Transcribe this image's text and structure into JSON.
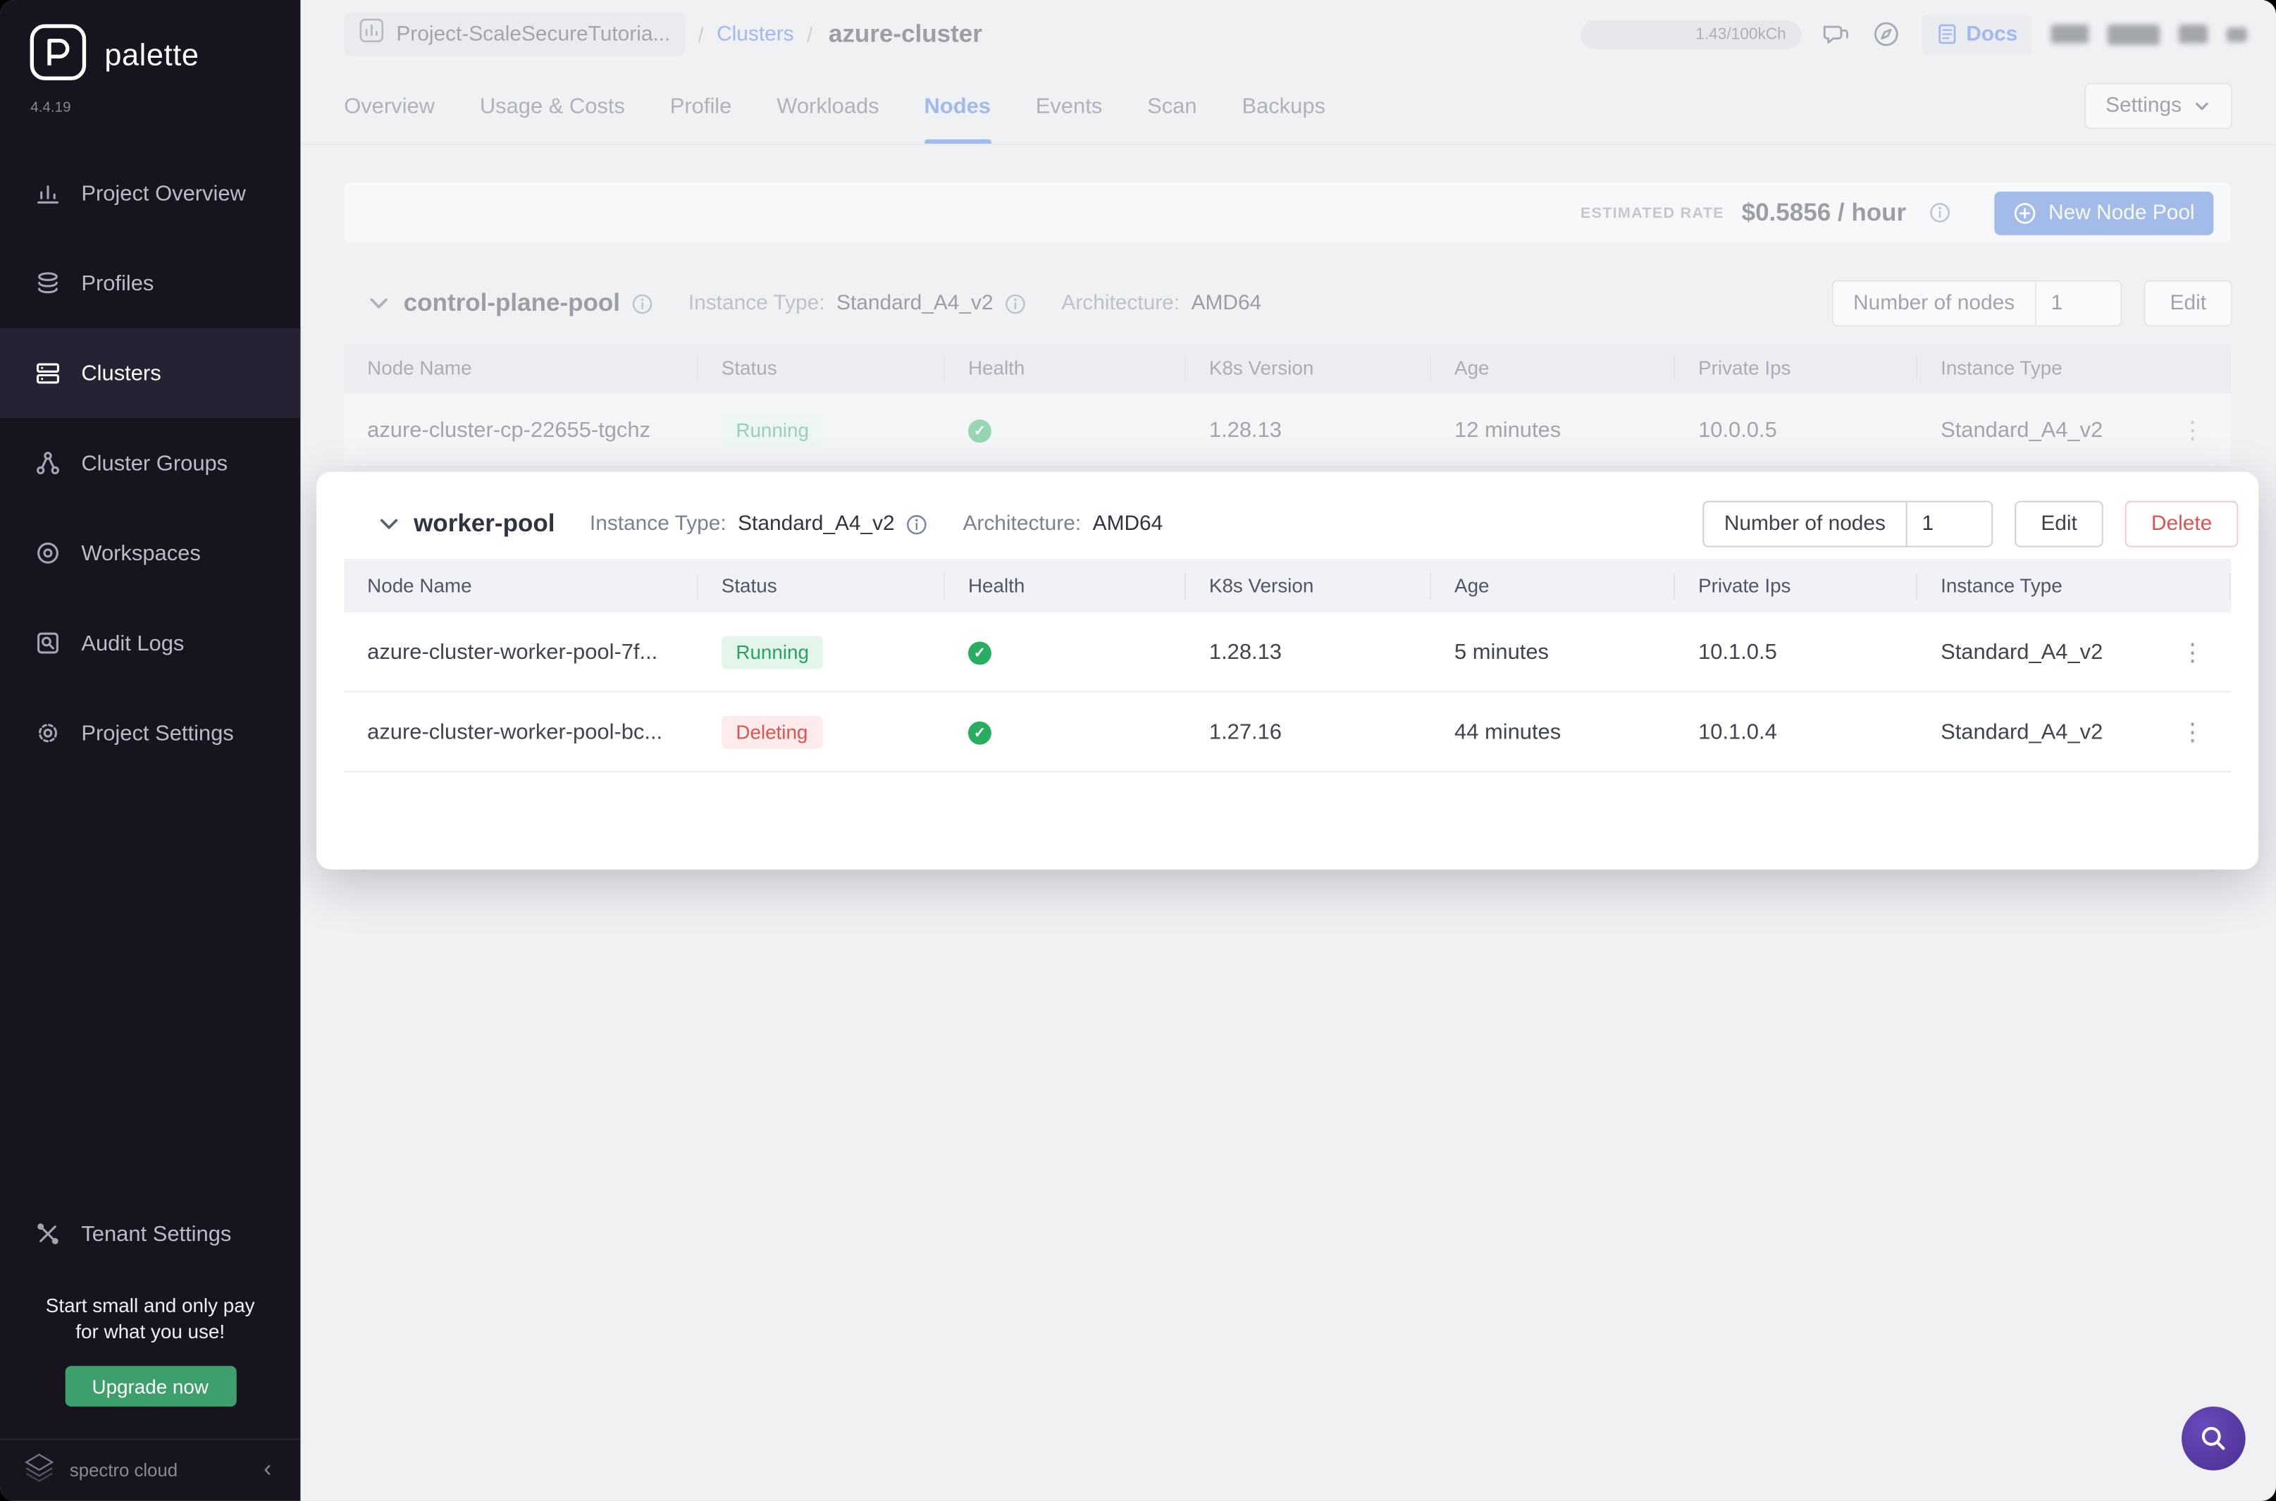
{
  "colors": {
    "accent_blue": "#3d6fe0",
    "success_green": "#27a35f",
    "danger_red": "#e0524e",
    "sidebar_bg": "#17141f",
    "upgrade_green": "#3da06c",
    "help_purple": "#4b2f91"
  },
  "sidebar": {
    "brand": "palette",
    "version": "4.4.19",
    "items": [
      {
        "label": "Project Overview"
      },
      {
        "label": "Profiles"
      },
      {
        "label": "Clusters"
      },
      {
        "label": "Cluster Groups"
      },
      {
        "label": "Workspaces"
      },
      {
        "label": "Audit Logs"
      },
      {
        "label": "Project Settings"
      }
    ],
    "tenant_settings": "Tenant Settings",
    "promo_line1": "Start small and only pay",
    "promo_line2": "for what you use!",
    "upgrade_button": "Upgrade now",
    "footer_brand": "spectro cloud"
  },
  "header": {
    "project": "Project-ScaleSecureTutoria...",
    "sep1": "/",
    "clusters_link": "Clusters",
    "sep2": "/",
    "cluster_name": "azure-cluster",
    "usage_badge": "1.43/100kCh",
    "docs_label": "Docs"
  },
  "tabs": [
    {
      "label": "Overview"
    },
    {
      "label": "Usage & Costs"
    },
    {
      "label": "Profile"
    },
    {
      "label": "Workloads"
    },
    {
      "label": "Nodes"
    },
    {
      "label": "Events"
    },
    {
      "label": "Scan"
    },
    {
      "label": "Backups"
    }
  ],
  "settings_button": "Settings",
  "rate_bar": {
    "label": "ESTIMATED RATE",
    "value": "$0.5856 / hour",
    "new_node_pool": "New Node Pool"
  },
  "pools": [
    {
      "name": "control-plane-pool",
      "instance_type_label": "Instance Type:",
      "instance_type": "Standard_A4_v2",
      "architecture_label": "Architecture:",
      "architecture": "AMD64",
      "nodes_label": "Number of nodes",
      "nodes_value": "1",
      "edit_button": "Edit",
      "columns": [
        "Node Name",
        "Status",
        "Health",
        "K8s Version",
        "Age",
        "Private Ips",
        "Instance Type"
      ],
      "rows": [
        {
          "name": "azure-cluster-cp-22655-tgchz",
          "status": "Running",
          "k8s_version": "1.28.13",
          "age": "12 minutes",
          "private_ip": "10.0.0.5",
          "instance_type": "Standard_A4_v2"
        }
      ]
    },
    {
      "name": "worker-pool",
      "instance_type_label": "Instance Type:",
      "instance_type": "Standard_A4_v2",
      "architecture_label": "Architecture:",
      "architecture": "AMD64",
      "nodes_label": "Number of nodes",
      "nodes_value": "1",
      "edit_button": "Edit",
      "delete_button": "Delete",
      "columns": [
        "Node Name",
        "Status",
        "Health",
        "K8s Version",
        "Age",
        "Private Ips",
        "Instance Type"
      ],
      "rows": [
        {
          "name": "azure-cluster-worker-pool-7f...",
          "status": "Running",
          "k8s_version": "1.28.13",
          "age": "5 minutes",
          "private_ip": "10.1.0.5",
          "instance_type": "Standard_A4_v2"
        },
        {
          "name": "azure-cluster-worker-pool-bc...",
          "status": "Deleting",
          "k8s_version": "1.27.16",
          "age": "44 minutes",
          "private_ip": "10.1.0.4",
          "instance_type": "Standard_A4_v2"
        }
      ]
    }
  ]
}
